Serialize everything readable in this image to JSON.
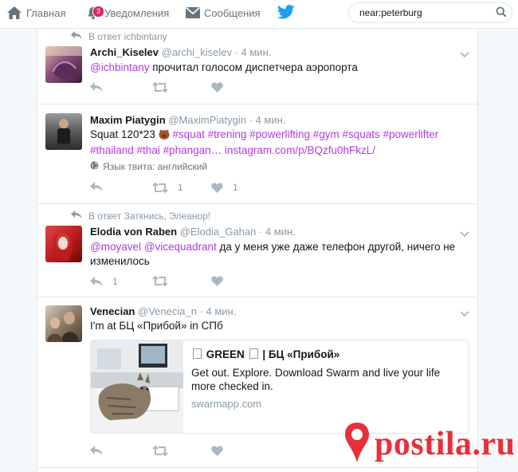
{
  "nav": {
    "home_label": "Главная",
    "notifications_label": "Уведомления",
    "notifications_badge": "3",
    "messages_label": "Сообщения",
    "search_value": "near:peterburg"
  },
  "colors": {
    "accent": "#b23ae0",
    "badge": "#e0245e",
    "twitter_blue": "#1da1f2",
    "watermark": "#e8303a"
  },
  "tweets": [
    {
      "context": "В ответ ichbintany",
      "fullname": "Archi_Kiselev",
      "handle": "@archi_kiselev",
      "sep": " · ",
      "time": "4 мин.",
      "mention1": "@ichbintany",
      "body": " прочитал голосом диспетчера аэропорта"
    },
    {
      "fullname": "Maxim Piatygin",
      "handle": "@MaximPiatygin",
      "sep": " · ",
      "time": "4 мин.",
      "line1_plain": "Squat 120*23 ",
      "line1_tags": "#squat #trening #powerlifting #gym #squats #powerlifter",
      "line2_tags": "#thailand #thai #phangan…",
      "line2_link": "instagram.com/p/BQzfu0hFkzL/",
      "lang": "Язык твита: английский",
      "retweets": "1",
      "likes": "1"
    },
    {
      "context": "В ответ Заткнись, Элеанор!",
      "fullname": "Elodia von Raben",
      "handle": "@Elodia_Gahan",
      "sep": " · ",
      "time": "4 мин.",
      "mention1": "@moyavel",
      "mention2": "@vicequadrant",
      "body": " да у меня уже даже телефон другой, ничего не изменилось",
      "replies": "1"
    },
    {
      "fullname": "Venecian",
      "handle": "@Venecia_n",
      "sep": " · ",
      "time": "4 мин.",
      "body": "I'm at БЦ «Прибой» in СПб",
      "card": {
        "title_a": "GREEN",
        "title_b": "| БЦ «Прибой»",
        "desc": "Get out. Explore. Download Swarm and live your life more checked in.",
        "domain": "swarmapp.com"
      }
    }
  ],
  "watermark": {
    "text": "postila.ru"
  }
}
